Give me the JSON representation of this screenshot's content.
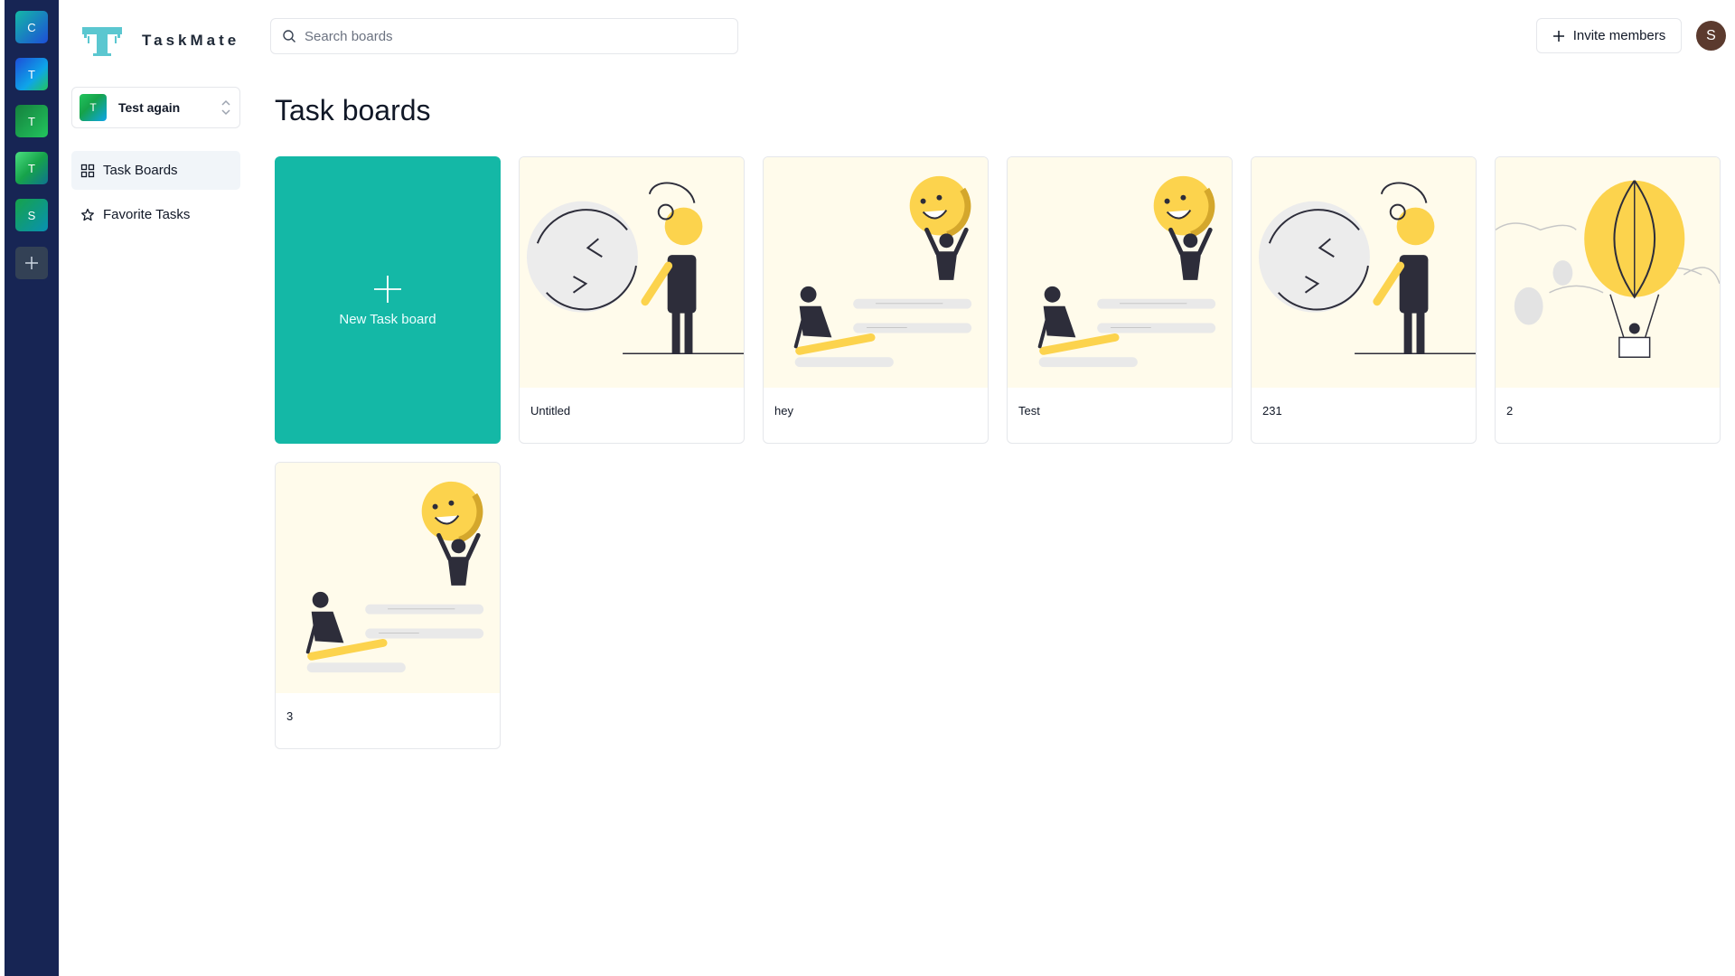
{
  "app": {
    "name": "TaskMate"
  },
  "workspaces": [
    {
      "initial": "C",
      "color": "#0ea5e9"
    },
    {
      "initial": "T",
      "color": "#2563eb"
    },
    {
      "initial": "T",
      "color": "#16a34a"
    },
    {
      "initial": "T",
      "color": "#22c55e"
    },
    {
      "initial": "S",
      "color": "#0d9488"
    }
  ],
  "workspace_switcher": {
    "initial": "T",
    "name": "Test again"
  },
  "sidebar": {
    "items": [
      {
        "label": "Task Boards",
        "active": true,
        "icon": "grid-icon"
      },
      {
        "label": "Favorite Tasks",
        "active": false,
        "icon": "star-icon"
      }
    ]
  },
  "search": {
    "placeholder": "Search boards",
    "value": ""
  },
  "header": {
    "invite_label": "Invite members",
    "user_initial": "S"
  },
  "main": {
    "title": "Task boards",
    "new_board_label": "New Task board",
    "boards": [
      {
        "name": "Untitled",
        "illustration": "refresh-woman"
      },
      {
        "name": "hey",
        "illustration": "smiley-teamwork"
      },
      {
        "name": "Test",
        "illustration": "smiley-teamwork"
      },
      {
        "name": "231",
        "illustration": "refresh-woman"
      },
      {
        "name": "2",
        "illustration": "hot-air-balloon"
      },
      {
        "name": "3",
        "illustration": "smiley-teamwork"
      }
    ]
  },
  "colors": {
    "accent": "#14b8a6",
    "rail": "#172554",
    "illustration_yellow": "#fcd34d"
  }
}
